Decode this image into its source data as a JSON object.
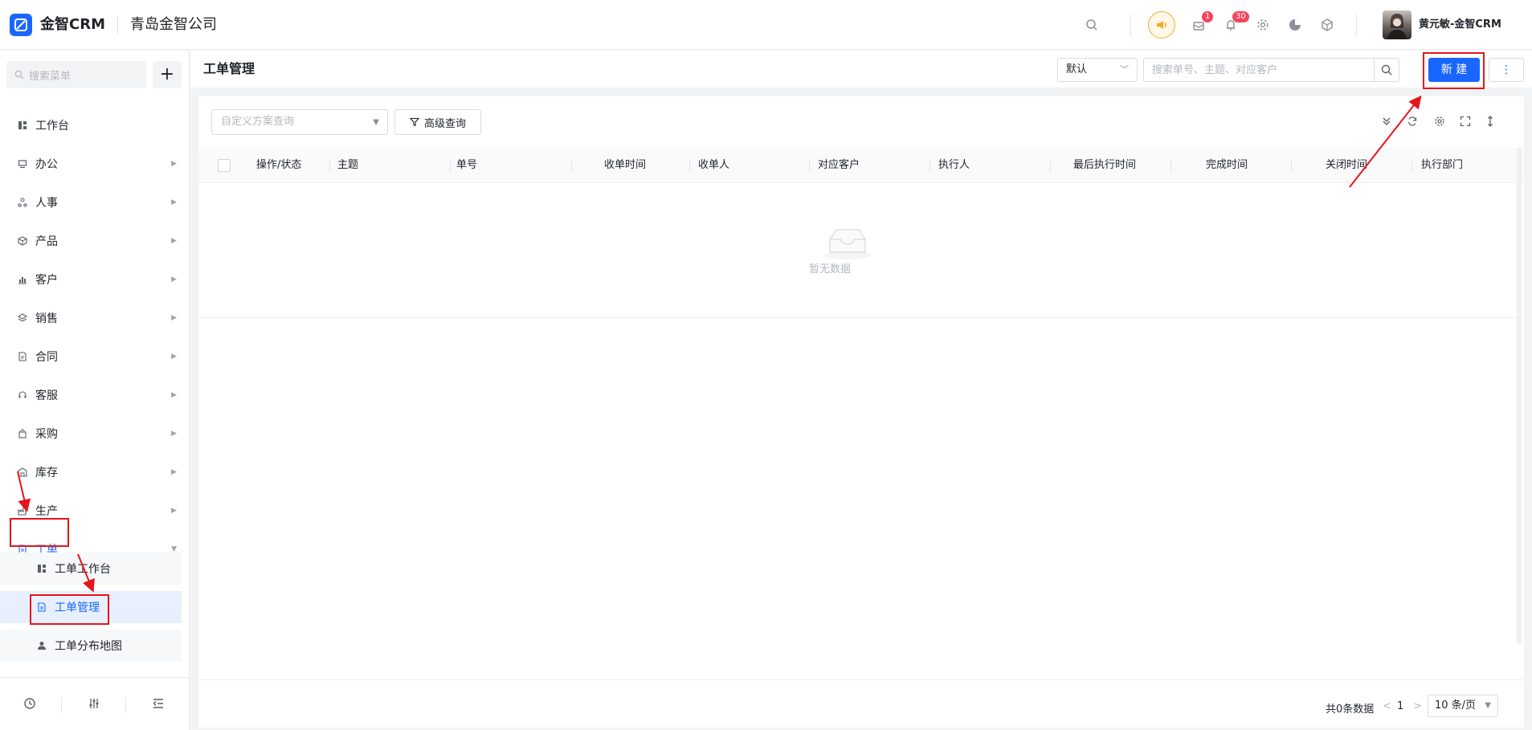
{
  "topbar": {
    "app_name": "金智CRM",
    "company": "青岛金智公司",
    "mail_badge": "1",
    "bell_badge": "30",
    "user_name": "黄元敏-金智CRM",
    "icons": [
      "search-icon",
      "announcement-icon",
      "mail-icon",
      "bell-icon",
      "gear-icon",
      "pie-chart-icon",
      "cube-icon"
    ]
  },
  "sidebar": {
    "search_placeholder": "搜索菜单",
    "add_label": "+",
    "items": [
      {
        "label": "工作台",
        "icon": "dashboard-icon"
      },
      {
        "label": "办公",
        "icon": "monitor-icon"
      },
      {
        "label": "人事",
        "icon": "org-icon"
      },
      {
        "label": "产品",
        "icon": "box-icon"
      },
      {
        "label": "客户",
        "icon": "chart-icon"
      },
      {
        "label": "销售",
        "icon": "layers-icon"
      },
      {
        "label": "合同",
        "icon": "contract-icon"
      },
      {
        "label": "客服",
        "icon": "headset-icon"
      },
      {
        "label": "采购",
        "icon": "bag-icon"
      },
      {
        "label": "库存",
        "icon": "warehouse-icon"
      },
      {
        "label": "生产",
        "icon": "factory-icon"
      },
      {
        "label": "工单",
        "icon": "document-icon"
      }
    ],
    "sub_items": [
      {
        "label": "工单工作台",
        "icon": "dashboard-icon"
      },
      {
        "label": "工单管理",
        "icon": "document-icon"
      },
      {
        "label": "工单分布地图",
        "icon": "user-icon"
      }
    ]
  },
  "header": {
    "title": "工单管理",
    "view_select": "默认",
    "search_placeholder": "搜索单号、主题、对应客户",
    "new_button": "新 建",
    "more_button": "⋮"
  },
  "toolbar": {
    "scheme_placeholder": "自定义方案查询",
    "advanced_button": "高级查询"
  },
  "table": {
    "columns": [
      "操作/状态",
      "主题",
      "单号",
      "收单时间",
      "收单人",
      "对应客户",
      "执行人",
      "最后执行时间",
      "完成时间",
      "关闭时间",
      "执行部门"
    ],
    "empty_text": "暂无数据"
  },
  "pagination": {
    "total": "共0条数据",
    "prev": "<",
    "page": "1",
    "next": ">",
    "page_size": "10 条/页"
  },
  "colors": {
    "primary": "#1966ff",
    "annotation": "#e8141b",
    "badge": "#f5455b",
    "announce": "#f7a829"
  }
}
